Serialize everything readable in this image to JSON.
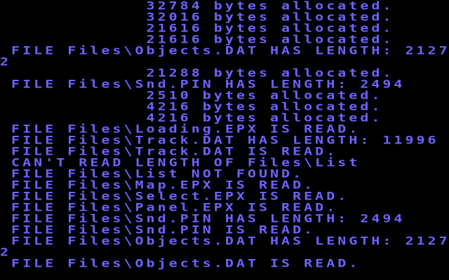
{
  "screen": {
    "text_color": "#6b63ff",
    "background_color": "#000000",
    "lines": [
      "             32784 bytes allocated.",
      "             32016 bytes allocated.",
      "             21616 bytes allocated.",
      "             21616 bytes allocated.",
      " FILE Files\\Objects.DAT HAS LENGTH: 2127",
      "2",
      "             21288 bytes allocated.",
      " FILE Files\\Snd.PIN HAS LENGTH: 2494",
      "             2510 bytes allocated.",
      "             4216 bytes allocated.",
      "             4216 bytes allocated.",
      " FILE Files\\Loading.EPX IS READ.",
      " FILE Files\\Track.DAT HAS LENGTH: 11996",
      " FILE Files\\Track.DAT IS READ.",
      " CAN'T READ LENGTH OF Files\\List",
      " FILE Files\\List NOT FOUND.",
      " FILE Files\\Map.EPX IS READ.",
      " FILE Files\\Select.EPX IS READ.",
      " FILE Files\\Panel.EPX IS READ.",
      " FILE Files\\Snd.PIN HAS LENGTH: 2494",
      " FILE Files\\Snd.PIN IS READ.",
      " FILE Files\\Objects.DAT HAS LENGTH: 2127",
      "2",
      " FILE Files\\Objects.DAT IS READ."
    ]
  }
}
